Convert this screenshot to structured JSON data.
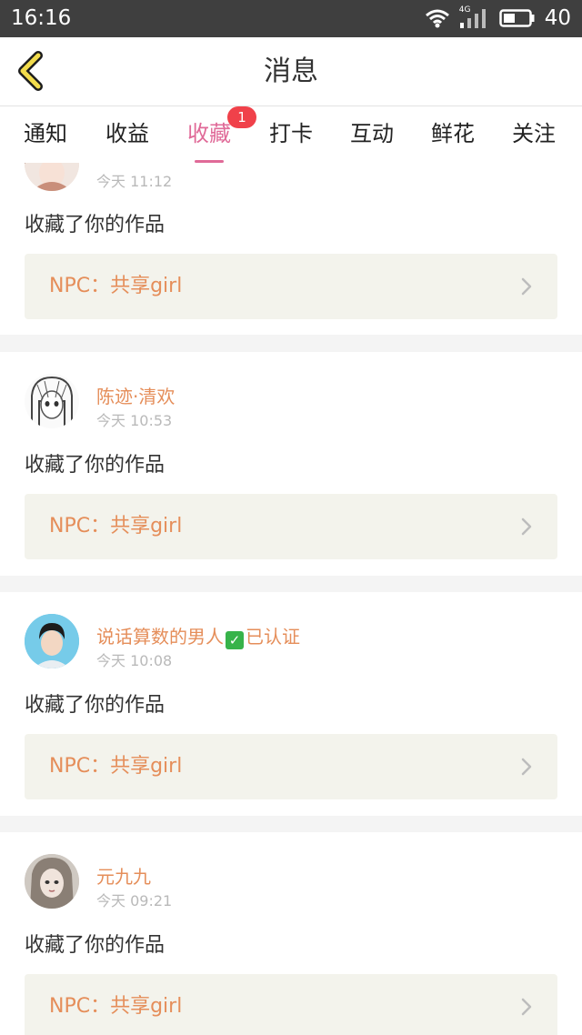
{
  "status_bar": {
    "time": "16:16",
    "network": "4G",
    "battery": "40"
  },
  "header": {
    "title": "消息",
    "back_icon": "chevron-left-icon"
  },
  "tabs": [
    {
      "label": "通知"
    },
    {
      "label": "收益"
    },
    {
      "label": "收藏",
      "active": true,
      "badge": "1"
    },
    {
      "label": "打卡"
    },
    {
      "label": "互动"
    },
    {
      "label": "鲜花"
    },
    {
      "label": "关注"
    }
  ],
  "messages": [
    {
      "user": "",
      "time": "今天 11:12",
      "action": "收藏了你的作品",
      "work_title": "NPC：共享girl"
    },
    {
      "user": "陈迹·清欢",
      "time": "今天 10:53",
      "action": "收藏了你的作品",
      "work_title": "NPC：共享girl"
    },
    {
      "user_name_prefix": "说话算数的男人",
      "verified_mark": "✓",
      "user_name_suffix": "已认证",
      "time": "今天 10:08",
      "action": "收藏了你的作品",
      "work_title": "NPC：共享girl"
    },
    {
      "user": "元九九",
      "time": "今天 09:21",
      "action": "收藏了你的作品",
      "work_title": "NPC：共享girl"
    }
  ],
  "colors": {
    "accent": "#e06a98",
    "username": "#e58e5a",
    "badge": "#f0414a",
    "verified": "#37b34a",
    "link_bg": "#f3f3ec"
  }
}
